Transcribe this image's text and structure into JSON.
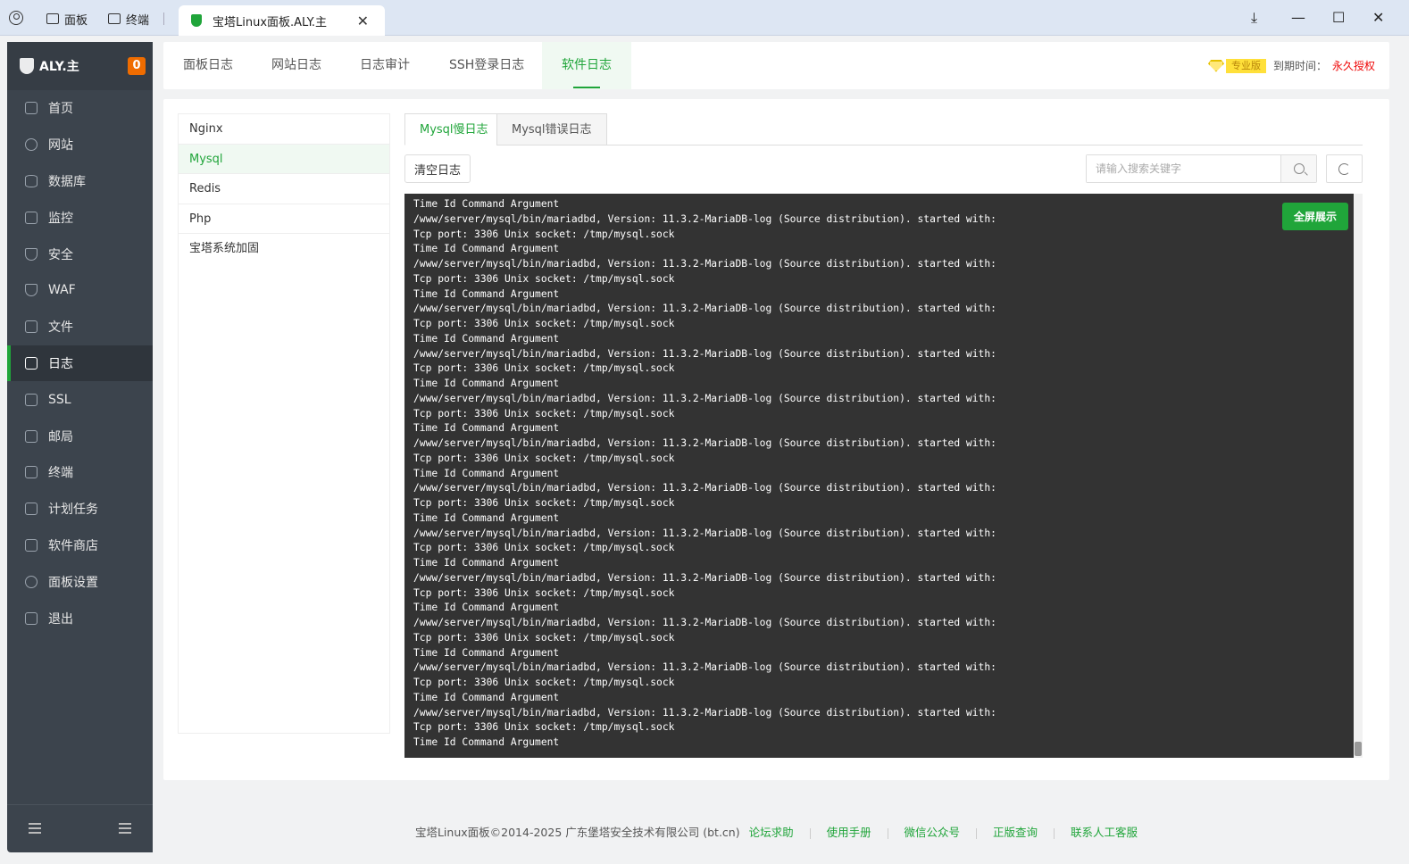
{
  "browser": {
    "tabs": [
      {
        "label": "面板"
      },
      {
        "label": "终端"
      }
    ],
    "active_tab": {
      "title": "宝塔Linux面板.ALY.主",
      "close": "✕"
    },
    "controls": {
      "download": "⤓",
      "minimize": "—",
      "maximize": "☐",
      "close": "✕"
    }
  },
  "sidebar": {
    "title": "ALY.主",
    "badge": "0",
    "items": [
      {
        "label": "首页",
        "icon": "home-icon"
      },
      {
        "label": "网站",
        "icon": "globe-icon"
      },
      {
        "label": "数据库",
        "icon": "database-icon"
      },
      {
        "label": "监控",
        "icon": "monitor-icon"
      },
      {
        "label": "安全",
        "icon": "shield-icon"
      },
      {
        "label": "WAF",
        "icon": "waf-icon"
      },
      {
        "label": "文件",
        "icon": "folder-icon"
      },
      {
        "label": "日志",
        "icon": "log-icon",
        "active": true
      },
      {
        "label": "SSL",
        "icon": "ssl-icon"
      },
      {
        "label": "邮局",
        "icon": "mail-icon"
      },
      {
        "label": "终端",
        "icon": "terminal-icon"
      },
      {
        "label": "计划任务",
        "icon": "calendar-icon"
      },
      {
        "label": "软件商店",
        "icon": "store-icon"
      },
      {
        "label": "面板设置",
        "icon": "gear-icon"
      },
      {
        "label": "退出",
        "icon": "logout-icon"
      }
    ]
  },
  "header": {
    "tabs": [
      "面板日志",
      "网站日志",
      "日志审计",
      "SSH登录日志",
      "软件日志"
    ],
    "active_tab": "软件日志",
    "edition": "专业版",
    "expire_label": "到期时间：",
    "expire_value": "永久授权"
  },
  "categories": [
    "Nginx",
    "Mysql",
    "Redis",
    "Php",
    "宝塔系统加固"
  ],
  "active_category": "Mysql",
  "subtabs": [
    "Mysql慢日志",
    "Mysql错误日志"
  ],
  "toolbar": {
    "clear_label": "清空日志",
    "search_placeholder": "请输入搜索关键字"
  },
  "log": {
    "fullscreen_label": "全屏展示",
    "lines": [
      "Time Id Command Argument",
      "/www/server/mysql/bin/mariadbd, Version: 11.3.2-MariaDB-log (Source distribution). started with:",
      "Tcp port: 3306 Unix socket: /tmp/mysql.sock",
      "Time Id Command Argument",
      "/www/server/mysql/bin/mariadbd, Version: 11.3.2-MariaDB-log (Source distribution). started with:",
      "Tcp port: 3306 Unix socket: /tmp/mysql.sock",
      "Time Id Command Argument",
      "/www/server/mysql/bin/mariadbd, Version: 11.3.2-MariaDB-log (Source distribution). started with:",
      "Tcp port: 3306 Unix socket: /tmp/mysql.sock",
      "Time Id Command Argument",
      "/www/server/mysql/bin/mariadbd, Version: 11.3.2-MariaDB-log (Source distribution). started with:",
      "Tcp port: 3306 Unix socket: /tmp/mysql.sock",
      "Time Id Command Argument",
      "/www/server/mysql/bin/mariadbd, Version: 11.3.2-MariaDB-log (Source distribution). started with:",
      "Tcp port: 3306 Unix socket: /tmp/mysql.sock",
      "Time Id Command Argument",
      "/www/server/mysql/bin/mariadbd, Version: 11.3.2-MariaDB-log (Source distribution). started with:",
      "Tcp port: 3306 Unix socket: /tmp/mysql.sock",
      "Time Id Command Argument",
      "/www/server/mysql/bin/mariadbd, Version: 11.3.2-MariaDB-log (Source distribution). started with:",
      "Tcp port: 3306 Unix socket: /tmp/mysql.sock",
      "Time Id Command Argument",
      "/www/server/mysql/bin/mariadbd, Version: 11.3.2-MariaDB-log (Source distribution). started with:",
      "Tcp port: 3306 Unix socket: /tmp/mysql.sock",
      "Time Id Command Argument",
      "/www/server/mysql/bin/mariadbd, Version: 11.3.2-MariaDB-log (Source distribution). started with:",
      "Tcp port: 3306 Unix socket: /tmp/mysql.sock",
      "Time Id Command Argument",
      "/www/server/mysql/bin/mariadbd, Version: 11.3.2-MariaDB-log (Source distribution). started with:",
      "Tcp port: 3306 Unix socket: /tmp/mysql.sock",
      "Time Id Command Argument",
      "/www/server/mysql/bin/mariadbd, Version: 11.3.2-MariaDB-log (Source distribution). started with:",
      "Tcp port: 3306 Unix socket: /tmp/mysql.sock",
      "Time Id Command Argument",
      "/www/server/mysql/bin/mariadbd, Version: 11.3.2-MariaDB-log (Source distribution). started with:",
      "Tcp port: 3306 Unix socket: /tmp/mysql.sock",
      "Time Id Command Argument"
    ]
  },
  "footer": {
    "copyright": "宝塔Linux面板©2014-2025 广东堡塔安全技术有限公司 (bt.cn)",
    "links": [
      "论坛求助",
      "使用手册",
      "微信公众号",
      "正版查询",
      "联系人工客服"
    ]
  },
  "colors": {
    "accent": "#20a53a",
    "sidebar_bg": "#3c444d",
    "log_bg": "#333333",
    "badge": "#ef6c00",
    "license": "#ef0808"
  }
}
